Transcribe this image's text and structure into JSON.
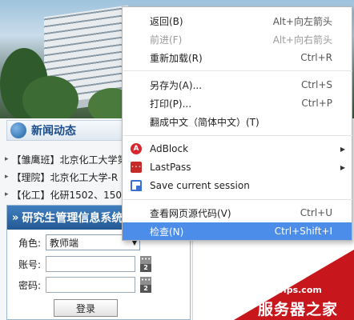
{
  "page": {
    "news_title": "新闻动态",
    "news_items": [
      "【雏鹰班】北京化工大学第",
      "【理院】北京化工大学-R",
      "【化工】化研1502、150"
    ],
    "login": {
      "title": "研究生管理信息系统",
      "role_label": "角色:",
      "role_value": "教师端",
      "account_label": "账号:",
      "password_label": "密码:",
      "badge_number": "2",
      "login_button": "登录"
    }
  },
  "context_menu": {
    "groups": [
      [
        {
          "label": "返回(B)",
          "shortcut": "Alt+向左箭头",
          "enabled": true
        },
        {
          "label": "前进(F)",
          "shortcut": "Alt+向右箭头",
          "enabled": false
        },
        {
          "label": "重新加载(R)",
          "shortcut": "Ctrl+R",
          "enabled": true
        }
      ],
      [
        {
          "label": "另存为(A)...",
          "shortcut": "Ctrl+S",
          "enabled": true
        },
        {
          "label": "打印(P)...",
          "shortcut": "Ctrl+P",
          "enabled": true
        },
        {
          "label": "翻成中文（简体中文）(T)",
          "shortcut": "",
          "enabled": true
        }
      ],
      [
        {
          "label": "AdBlock",
          "icon": "adblock-icon",
          "submenu": true
        },
        {
          "label": "LastPass",
          "icon": "lastpass-icon",
          "submenu": true
        },
        {
          "label": "Save current session",
          "icon": "save-session-icon",
          "submenu": false
        }
      ],
      [
        {
          "label": "查看网页源代码(V)",
          "shortcut": "Ctrl+U",
          "enabled": true
        },
        {
          "label": "检查(N)",
          "shortcut": "Ctrl+Shift+I",
          "enabled": true,
          "highlighted": true
        }
      ]
    ],
    "highlight_color": "#4b8de8"
  },
  "watermark": {
    "url": "www.zzvips.com",
    "name": "服务器之家",
    "color": "#c8161d"
  }
}
